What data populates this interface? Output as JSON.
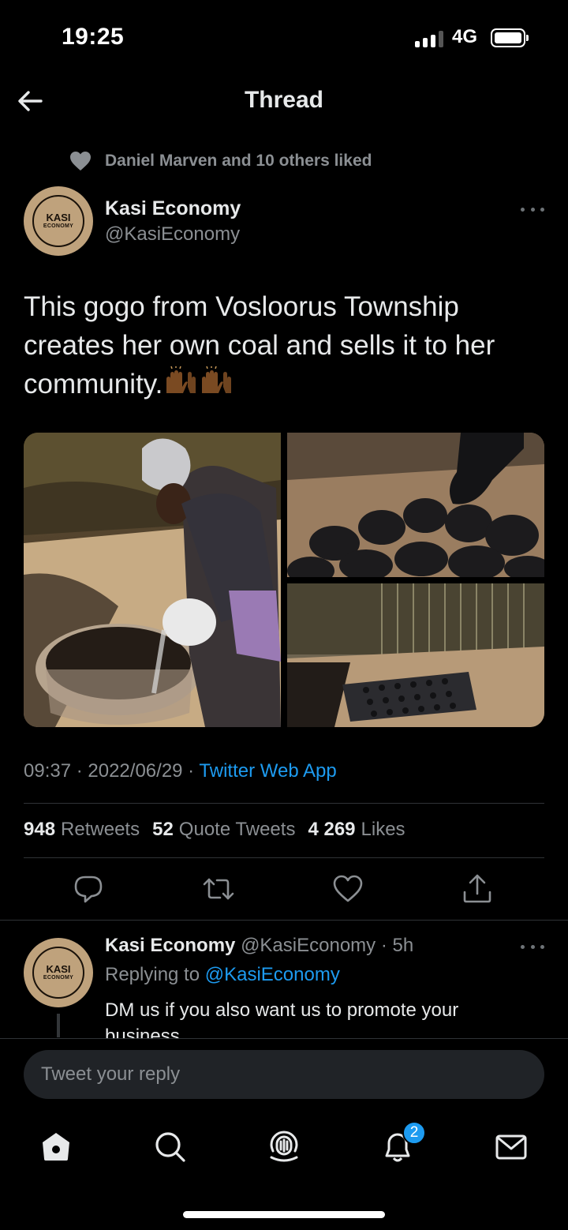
{
  "status_bar": {
    "time": "19:25",
    "network": "4G",
    "signal_bars": 3,
    "signal_bars_total": 4
  },
  "header": {
    "title": "Thread",
    "back_icon": "arrow-left-icon"
  },
  "liked_by": {
    "text": "Daniel Marven and 10 others liked",
    "icon": "heart-icon"
  },
  "tweet": {
    "author_name": "Kasi Economy",
    "author_handle": "@KasiEconomy",
    "avatar_text_1": "KASI",
    "avatar_text_2": "ECONOMY",
    "text": "This gogo from Vosloorus Township creates her own coal and sells it to her community.",
    "emoji": "🙌🏾🙌🏾",
    "time": "09:37",
    "date": "2022/06/29",
    "source": "Twitter Web App",
    "stats": [
      {
        "count": "948",
        "label": "Retweets"
      },
      {
        "count": "52",
        "label": "Quote Tweets"
      },
      {
        "count": "4 269",
        "label": "Likes"
      }
    ],
    "images": [
      "woman-pouring-water-photo",
      "hand-shaping-coal-photo",
      "coal-drying-yard-photo"
    ]
  },
  "reply": {
    "author_name": "Kasi Economy",
    "author_handle": "@KasiEconomy",
    "separator": "·",
    "age": "5h",
    "replying_prefix": "Replying to",
    "replying_to": "@KasiEconomy",
    "text": "DM us if you also want us to promote your business"
  },
  "compose": {
    "placeholder": "Tweet your reply"
  },
  "tabbar": {
    "items": [
      "home-icon",
      "search-icon",
      "spaces-icon",
      "notifications-icon",
      "messages-icon"
    ],
    "notification_badge": "2"
  },
  "colors": {
    "accent": "#1d9bf0",
    "background": "#000000",
    "secondary_text": "#8b8f93"
  }
}
